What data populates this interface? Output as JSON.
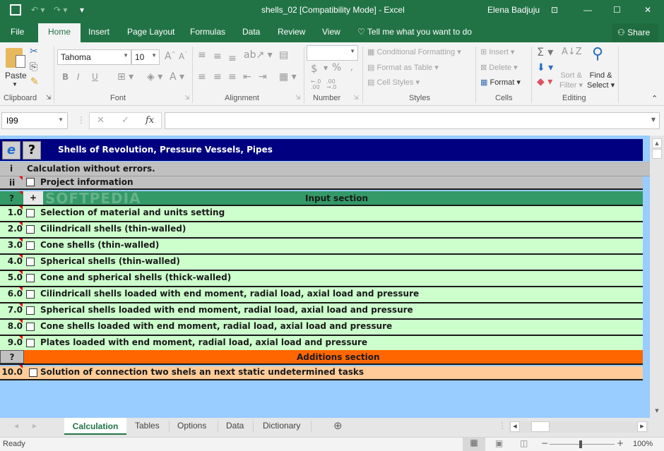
{
  "window": {
    "title": "shells_02  [Compatibility Mode] - Excel",
    "user": "Elena Badjuju",
    "share_label": "Share"
  },
  "ribbon_tabs": [
    "File",
    "Home",
    "Insert",
    "Page Layout",
    "Formulas",
    "Data",
    "Review",
    "View"
  ],
  "active_tab": "Home",
  "tell_me": "Tell me what you want to do",
  "ribbon": {
    "clipboard": {
      "paste": "Paste",
      "label": "Clipboard"
    },
    "font": {
      "name": "Tahoma",
      "size": "10",
      "label": "Font",
      "bold": "B",
      "italic": "I",
      "underline": "U"
    },
    "alignment": {
      "label": "Alignment"
    },
    "number": {
      "format": "",
      "label": "Number",
      "currency": "$",
      "percent": "%",
      "comma": ","
    },
    "styles": {
      "conditional": "Conditional Formatting",
      "format_table": "Format as Table",
      "cell_styles": "Cell Styles",
      "label": "Styles"
    },
    "cells": {
      "insert": "Insert",
      "delete": "Delete",
      "format": "Format",
      "label": "Cells"
    },
    "editing": {
      "sort1": "Sort &",
      "sort2": "Filter",
      "find1": "Find &",
      "find2": "Select",
      "label": "Editing"
    }
  },
  "formula_bar": {
    "name_box": "I99",
    "formula": ""
  },
  "sheet": {
    "header_title": "Shells of Revolution, Pressure Vessels, Pipes",
    "help_button": "?",
    "info_marker": "i",
    "status_message": "Calculation without errors.",
    "project_marker": "ii",
    "project_label": "Project information",
    "input_marker": "?",
    "input_plus": "+",
    "input_section": "Input section",
    "items": [
      {
        "num": "1.0",
        "label": "Selection of material and units setting"
      },
      {
        "num": "2.0",
        "label": "Cilindricall shells (thin-walled)"
      },
      {
        "num": "3.0",
        "label": "Cone shells (thin-walled)"
      },
      {
        "num": "4.0",
        "label": "Spherical shells (thin-walled)"
      },
      {
        "num": "5.0",
        "label": "Cone and spherical shells (thick-walled)"
      },
      {
        "num": "6.0",
        "label": "Cilindricall shells loaded with end moment, radial load, axial load and pressure"
      },
      {
        "num": "7.0",
        "label": "Spherical shells loaded with end moment, radial load, axial load and pressure"
      },
      {
        "num": "8.0",
        "label": "Cone shells loaded with end moment, radial load, axial load and pressure"
      },
      {
        "num": "9.0",
        "label": "Plates loaded with end moment, radial load, axial load and pressure"
      }
    ],
    "additions_marker": "?",
    "additions_section": "Additions section",
    "additions_items": [
      {
        "num": "10.0",
        "label": "Solution of connection two shels an next static undetermined tasks"
      }
    ],
    "watermark": "SOFTPEDIA"
  },
  "sheet_tabs": [
    "Calculation",
    "Tables",
    "Options",
    "Data",
    "Dictionary"
  ],
  "active_sheet": "Calculation",
  "status_bar": {
    "status": "Ready",
    "zoom": "100%"
  },
  "colors": {
    "excel_green": "#217346",
    "header_blue": "#000080",
    "input_green": "#339966",
    "row_green": "#ccffcc",
    "additions_orange": "#ff6600",
    "additions_row": "#ffcc99",
    "sheet_bg": "#99ccff"
  }
}
